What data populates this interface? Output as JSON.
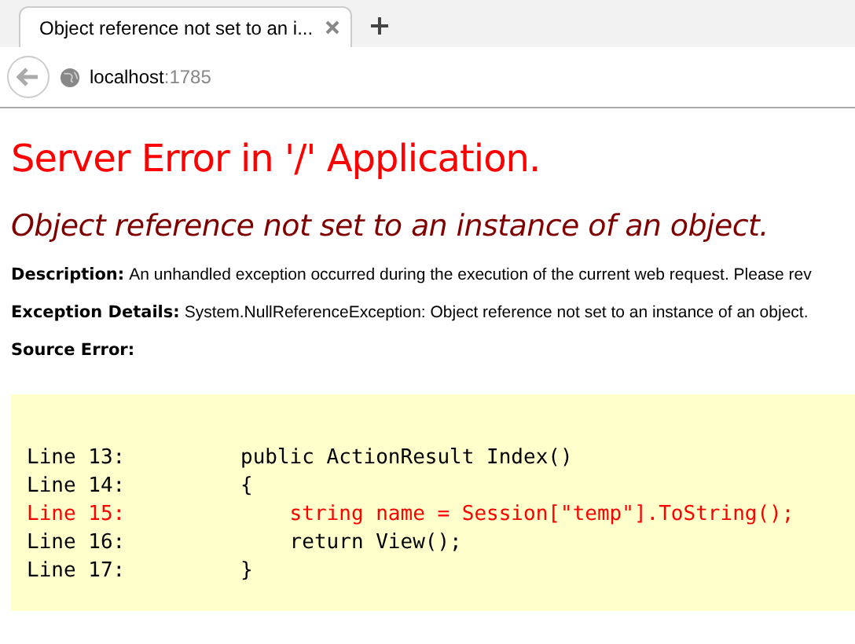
{
  "browser": {
    "tab": {
      "title": "Object reference not set to an i...",
      "selected": true
    },
    "address": {
      "host": "localhost",
      "port": ":1785"
    }
  },
  "page": {
    "title": "Server Error in '/' Application.",
    "message": "Object reference not set to an instance of an object.",
    "fields": [
      {
        "label": "Description:",
        "text": "An unhandled exception occurred during the execution of the current web request. Please rev"
      },
      {
        "label": "Exception Details:",
        "text": "System.NullReferenceException: Object reference not set to an instance of an object."
      },
      {
        "label": "Source Error:"
      }
    ],
    "source": [
      {
        "line": "Line 13:",
        "code": "public ActionResult Index()",
        "highlighted": false
      },
      {
        "line": "Line 14:",
        "code": "{",
        "highlighted": false
      },
      {
        "line": "Line 15:",
        "code": "    string name = Session[\"temp\"].ToString();",
        "highlighted": true
      },
      {
        "line": "Line 16:",
        "code": "    return View();",
        "highlighted": false
      },
      {
        "line": "Line 17:",
        "code": "}",
        "highlighted": false
      }
    ]
  }
}
